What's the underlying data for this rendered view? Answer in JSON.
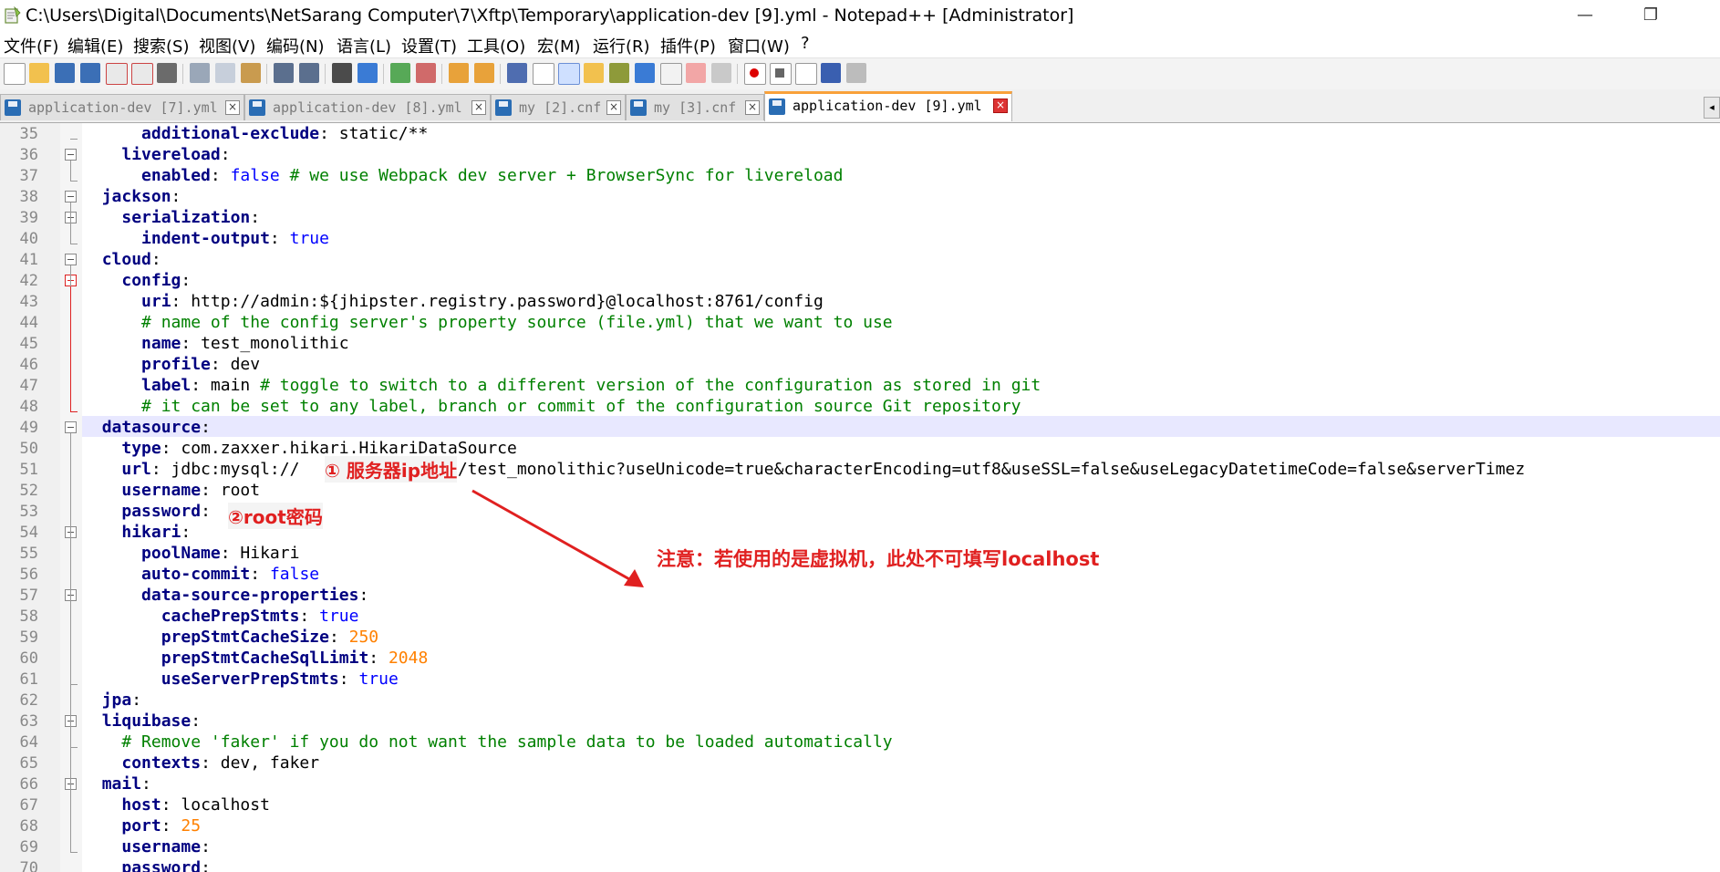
{
  "window": {
    "title": "C:\\Users\\Digital\\Documents\\NetSarang Computer\\7\\Xftp\\Temporary\\application-dev [9].yml - Notepad++ [Administrator]",
    "minimize": "—",
    "maximize": "❐"
  },
  "menu": [
    "文件(F)",
    "编辑(E)",
    "搜索(S)",
    "视图(V)",
    "编码(N)",
    "语言(L)",
    "设置(T)",
    "工具(O)",
    "宏(M)",
    "运行(R)",
    "插件(P)",
    "窗口(W)",
    "?"
  ],
  "tabs": [
    {
      "label": "application-dev [7].yml",
      "active": false
    },
    {
      "label": "application-dev [8].yml",
      "active": false
    },
    {
      "label": "my [2].cnf",
      "active": false
    },
    {
      "label": "my [3].cnf",
      "active": false
    },
    {
      "label": "application-dev [9].yml",
      "active": true
    }
  ],
  "tab_close_glyph": "×",
  "scroll_left_glyph": "◂",
  "editor": {
    "lines": [
      {
        "num": "35",
        "parts": [
          [
            "t",
            "      "
          ],
          [
            "k",
            "additional-exclude"
          ],
          [
            "t",
            ": static/**"
          ]
        ]
      },
      {
        "num": "36",
        "parts": [
          [
            "t",
            "    "
          ],
          [
            "k",
            "livereload"
          ],
          [
            "t",
            ":"
          ]
        ]
      },
      {
        "num": "37",
        "parts": [
          [
            "t",
            "      "
          ],
          [
            "k",
            "enabled"
          ],
          [
            "t",
            ": "
          ],
          [
            "b",
            "false"
          ],
          [
            "c",
            " # we use Webpack dev server + BrowserSync for livereload"
          ]
        ]
      },
      {
        "num": "38",
        "parts": [
          [
            "t",
            "  "
          ],
          [
            "k",
            "jackson"
          ],
          [
            "t",
            ":"
          ]
        ]
      },
      {
        "num": "39",
        "parts": [
          [
            "t",
            "    "
          ],
          [
            "k",
            "serialization"
          ],
          [
            "t",
            ":"
          ]
        ]
      },
      {
        "num": "40",
        "parts": [
          [
            "t",
            "      "
          ],
          [
            "k",
            "indent-output"
          ],
          [
            "t",
            ": "
          ],
          [
            "b",
            "true"
          ]
        ]
      },
      {
        "num": "41",
        "parts": [
          [
            "t",
            "  "
          ],
          [
            "k",
            "cloud"
          ],
          [
            "t",
            ":"
          ]
        ]
      },
      {
        "num": "42",
        "parts": [
          [
            "t",
            "    "
          ],
          [
            "k",
            "config"
          ],
          [
            "t",
            ":"
          ]
        ]
      },
      {
        "num": "43",
        "parts": [
          [
            "t",
            "      "
          ],
          [
            "k",
            "uri"
          ],
          [
            "t",
            ": http://admin:${jhipster.registry.password}@localhost:8761/config"
          ]
        ]
      },
      {
        "num": "44",
        "parts": [
          [
            "c",
            "      # name of the config server's property source (file.yml) that we want to use"
          ]
        ]
      },
      {
        "num": "45",
        "parts": [
          [
            "t",
            "      "
          ],
          [
            "k",
            "name"
          ],
          [
            "t",
            ": test_monolithic"
          ]
        ]
      },
      {
        "num": "46",
        "parts": [
          [
            "t",
            "      "
          ],
          [
            "k",
            "profile"
          ],
          [
            "t",
            ": dev"
          ]
        ]
      },
      {
        "num": "47",
        "parts": [
          [
            "t",
            "      "
          ],
          [
            "k",
            "label"
          ],
          [
            "t",
            ": main"
          ],
          [
            "c",
            " # toggle to switch to a different version of the configuration as stored in git"
          ]
        ]
      },
      {
        "num": "48",
        "parts": [
          [
            "c",
            "      # it can be set to any label, branch or commit of the configuration source Git repository"
          ]
        ]
      },
      {
        "num": "49",
        "parts": [
          [
            "t",
            "  "
          ],
          [
            "k",
            "datasource"
          ],
          [
            "t",
            ":"
          ]
        ]
      },
      {
        "num": "50",
        "parts": [
          [
            "t",
            "    "
          ],
          [
            "k",
            "type"
          ],
          [
            "t",
            ": com.zaxxer.hikari.HikariDataSource"
          ]
        ]
      },
      {
        "num": "51",
        "parts": [
          [
            "t",
            "    "
          ],
          [
            "k",
            "url"
          ],
          [
            "t",
            ": jdbc:mysql://"
          ],
          [
            "t",
            "           :3306/test_monolithic?useUnicode=true&characterEncoding=utf8&useSSL=false&useLegacyDatetimeCode=false&serverTimez"
          ]
        ]
      },
      {
        "num": "52",
        "parts": [
          [
            "t",
            "    "
          ],
          [
            "k",
            "username"
          ],
          [
            "t",
            ": root"
          ]
        ]
      },
      {
        "num": "53",
        "parts": [
          [
            "t",
            "    "
          ],
          [
            "k",
            "password"
          ],
          [
            "t",
            ":"
          ]
        ]
      },
      {
        "num": "54",
        "parts": [
          [
            "t",
            "    "
          ],
          [
            "k",
            "hikari"
          ],
          [
            "t",
            ":"
          ]
        ]
      },
      {
        "num": "55",
        "parts": [
          [
            "t",
            "      "
          ],
          [
            "k",
            "poolName"
          ],
          [
            "t",
            ": Hikari"
          ]
        ]
      },
      {
        "num": "56",
        "parts": [
          [
            "t",
            "      "
          ],
          [
            "k",
            "auto-commit"
          ],
          [
            "t",
            ": "
          ],
          [
            "b",
            "false"
          ]
        ]
      },
      {
        "num": "57",
        "parts": [
          [
            "t",
            "      "
          ],
          [
            "k",
            "data-source-properties"
          ],
          [
            "t",
            ":"
          ]
        ]
      },
      {
        "num": "58",
        "parts": [
          [
            "t",
            "        "
          ],
          [
            "k",
            "cachePrepStmts"
          ],
          [
            "t",
            ": "
          ],
          [
            "b",
            "true"
          ]
        ]
      },
      {
        "num": "59",
        "parts": [
          [
            "t",
            "        "
          ],
          [
            "k",
            "prepStmtCacheSize"
          ],
          [
            "t",
            ": "
          ],
          [
            "n",
            "250"
          ]
        ]
      },
      {
        "num": "60",
        "parts": [
          [
            "t",
            "        "
          ],
          [
            "k",
            "prepStmtCacheSqlLimit"
          ],
          [
            "t",
            ": "
          ],
          [
            "n",
            "2048"
          ]
        ]
      },
      {
        "num": "61",
        "parts": [
          [
            "t",
            "        "
          ],
          [
            "k",
            "useServerPrepStmts"
          ],
          [
            "t",
            ": "
          ],
          [
            "b",
            "true"
          ]
        ]
      },
      {
        "num": "62",
        "parts": [
          [
            "t",
            "  "
          ],
          [
            "k",
            "jpa"
          ],
          [
            "t",
            ":"
          ]
        ]
      },
      {
        "num": "63",
        "parts": [
          [
            "t",
            "  "
          ],
          [
            "k",
            "liquibase"
          ],
          [
            "t",
            ":"
          ]
        ]
      },
      {
        "num": "64",
        "parts": [
          [
            "c",
            "    # Remove 'faker' if you do not want the sample data to be loaded automatically"
          ]
        ]
      },
      {
        "num": "65",
        "parts": [
          [
            "t",
            "    "
          ],
          [
            "k",
            "contexts"
          ],
          [
            "t",
            ": dev, faker"
          ]
        ]
      },
      {
        "num": "66",
        "parts": [
          [
            "t",
            "  "
          ],
          [
            "k",
            "mail"
          ],
          [
            "t",
            ":"
          ]
        ]
      },
      {
        "num": "67",
        "parts": [
          [
            "t",
            "    "
          ],
          [
            "k",
            "host"
          ],
          [
            "t",
            ": localhost"
          ]
        ]
      },
      {
        "num": "68",
        "parts": [
          [
            "t",
            "    "
          ],
          [
            "k",
            "port"
          ],
          [
            "t",
            ": "
          ],
          [
            "n",
            "25"
          ]
        ]
      },
      {
        "num": "69",
        "parts": [
          [
            "t",
            "    "
          ],
          [
            "k",
            "username"
          ],
          [
            "t",
            ":"
          ]
        ]
      },
      {
        "num": "70",
        "parts": [
          [
            "t",
            "    "
          ],
          [
            "k",
            "password"
          ],
          [
            "t",
            ":"
          ]
        ]
      }
    ]
  },
  "annotations": {
    "server_ip": "① 服务器ip地址",
    "root_password": "②root密码",
    "note": "注意：若使用的是虚拟机，此处不可填写localhost"
  },
  "colors": {
    "keyword": "#000080",
    "boolean": "#0000ff",
    "comment": "#008000",
    "number": "#ff8000",
    "annotation": "#e02020",
    "current_line": "#e8e8ff"
  }
}
